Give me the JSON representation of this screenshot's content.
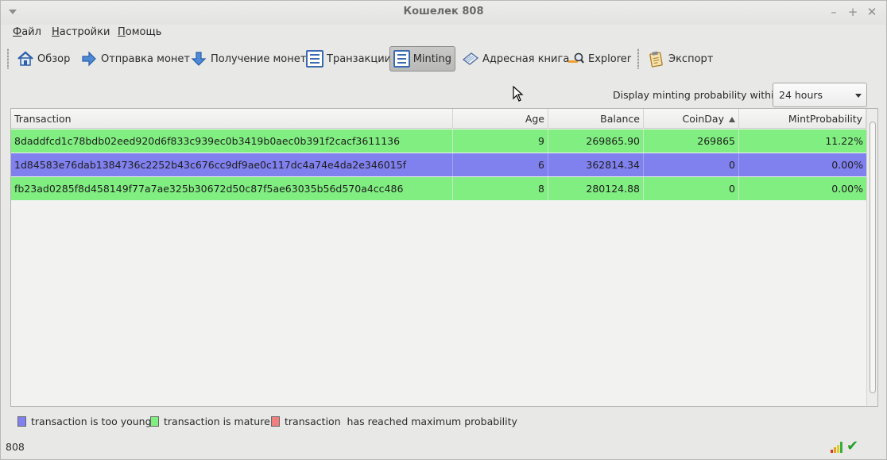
{
  "window": {
    "title": "Кошелек 808"
  },
  "menu": [
    "Файл",
    "Настройки",
    "Помощь"
  ],
  "toolbar": {
    "overview": "Обзор",
    "send": "Отправка монет",
    "receive": "Получение монет",
    "transactions": "Транзакции",
    "minting": "Minting",
    "addressbook": "Адресная книга",
    "explorer": "Explorer",
    "export": "Экспорт"
  },
  "minting": {
    "display_label": "Display minting probability within :",
    "selected_period": "24 hours"
  },
  "table": {
    "columns": [
      "Transaction",
      "Age",
      "Balance",
      "CoinDay",
      "MintProbability"
    ],
    "sorted_column": "CoinDay",
    "sort_direction": "ascending",
    "rows": [
      {
        "transaction": "8daddfcd1c78bdb02eed920d6f833c939ec0b3419b0aec0b391f2cacf3611136",
        "age": "9",
        "balance": "269865.90",
        "coinday": "269865",
        "mintprob": "11.22%",
        "status": "mature"
      },
      {
        "transaction": "1d84583e76dab1384736c2252b43c676cc9df9ae0c117dc4a74e4da2e346015f",
        "age": "6",
        "balance": "362814.34",
        "coinday": "0",
        "mintprob": "0.00%",
        "status": "young"
      },
      {
        "transaction": "fb23ad0285f8d458149f77a7ae325b30672d50c87f5ae63035b56d570a4cc486",
        "age": "8",
        "balance": "280124.88",
        "coinday": "0",
        "mintprob": "0.00%",
        "status": "mature"
      }
    ]
  },
  "legend": {
    "young": "transaction is too young",
    "mature": "transaction is mature",
    "max": "transaction  has reached maximum probability"
  },
  "colors": {
    "young": "#8080ee",
    "mature": "#80ee80",
    "max": "#ee8080"
  },
  "statusbar": {
    "text": "808"
  }
}
